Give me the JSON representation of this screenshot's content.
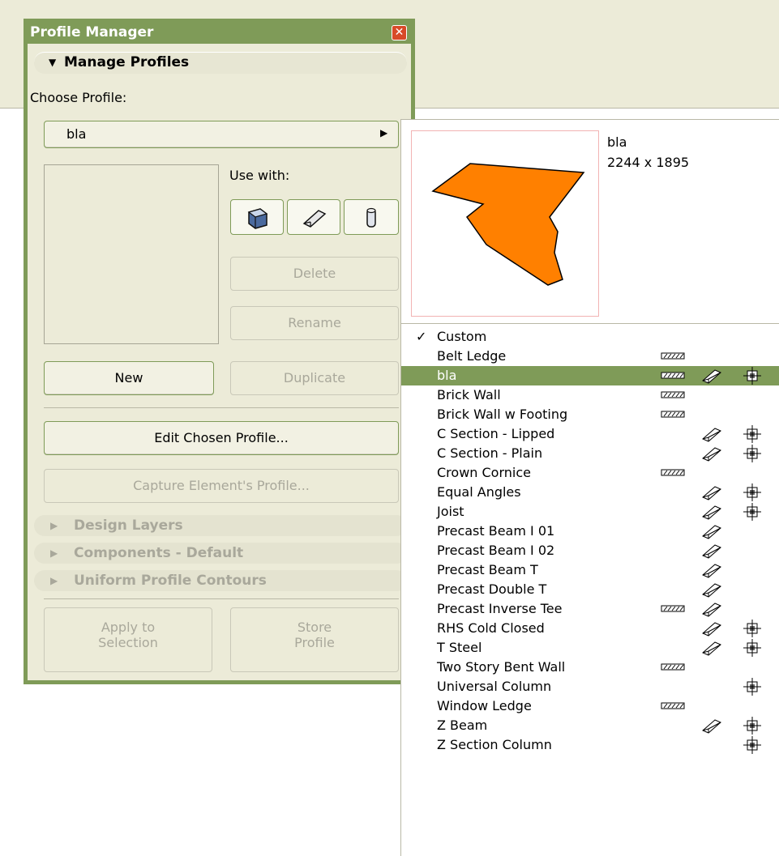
{
  "palette": {
    "title": "Profile Manager",
    "section_manage": "Manage Profiles",
    "choose_label": "Choose Profile:",
    "chosen_profile": "bla",
    "use_with_label": "Use with:",
    "delete_label": "Delete",
    "rename_label": "Rename",
    "new_label": "New",
    "duplicate_label": "Duplicate",
    "edit_label": "Edit Chosen Profile...",
    "capture_label": "Capture Element's Profile...",
    "section_layers": "Design Layers",
    "section_components": "Components - Default",
    "section_contours": "Uniform Profile Contours",
    "apply_line1": "Apply to",
    "apply_line2": "Selection",
    "store_line1": "Store",
    "store_line2": "Profile"
  },
  "popup": {
    "preview_name": "bla",
    "preview_size": "2244 x 1895",
    "fill_color": "#ff8000",
    "items": [
      {
        "label": "Custom",
        "checked": true,
        "wall": false,
        "beam": false,
        "column": false
      },
      {
        "label": "Belt Ledge",
        "wall": true,
        "beam": false,
        "column": false
      },
      {
        "label": "bla",
        "selected": true,
        "wall": true,
        "beam": true,
        "column": true
      },
      {
        "label": "Brick Wall",
        "wall": true,
        "beam": false,
        "column": false
      },
      {
        "label": "Brick Wall w Footing",
        "wall": true,
        "beam": false,
        "column": false
      },
      {
        "label": "C Section - Lipped",
        "wall": false,
        "beam": true,
        "column": true
      },
      {
        "label": "C Section - Plain",
        "wall": false,
        "beam": true,
        "column": true
      },
      {
        "label": "Crown Cornice",
        "wall": true,
        "beam": false,
        "column": false
      },
      {
        "label": "Equal Angles",
        "wall": false,
        "beam": true,
        "column": true
      },
      {
        "label": "Joist",
        "wall": false,
        "beam": true,
        "column": true
      },
      {
        "label": "Precast Beam I 01",
        "wall": false,
        "beam": true,
        "column": false
      },
      {
        "label": "Precast Beam I 02",
        "wall": false,
        "beam": true,
        "column": false
      },
      {
        "label": "Precast Beam T",
        "wall": false,
        "beam": true,
        "column": false
      },
      {
        "label": "Precast Double T",
        "wall": false,
        "beam": true,
        "column": false
      },
      {
        "label": "Precast Inverse Tee",
        "wall": true,
        "beam": true,
        "column": false
      },
      {
        "label": "RHS Cold Closed",
        "wall": false,
        "beam": true,
        "column": true
      },
      {
        "label": "T Steel",
        "wall": false,
        "beam": true,
        "column": true
      },
      {
        "label": "Two Story Bent Wall",
        "wall": true,
        "beam": false,
        "column": false
      },
      {
        "label": "Universal Column",
        "wall": false,
        "beam": false,
        "column": true
      },
      {
        "label": "Window Ledge",
        "wall": true,
        "beam": false,
        "column": false
      },
      {
        "label": "Z Beam",
        "wall": false,
        "beam": true,
        "column": true
      },
      {
        "label": "Z Section Column",
        "wall": false,
        "beam": false,
        "column": true
      }
    ]
  }
}
